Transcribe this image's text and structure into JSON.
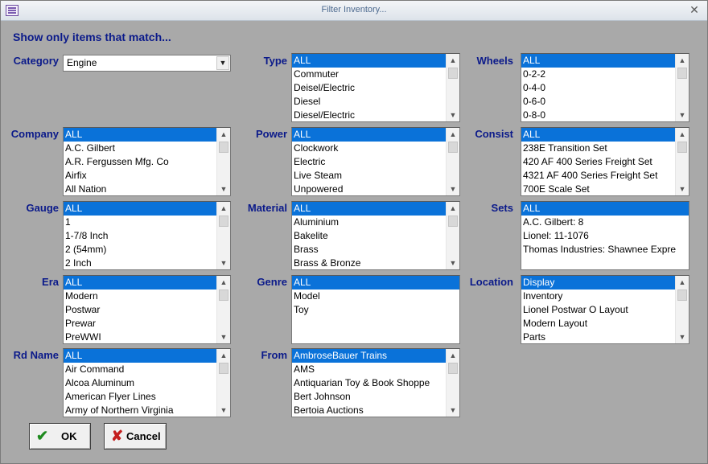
{
  "window": {
    "title": "Filter Inventory..."
  },
  "heading": "Show only items that match...",
  "category": {
    "label": "Category",
    "value": "Engine"
  },
  "lists": {
    "type": {
      "label": "Type",
      "items": [
        "ALL",
        "Commuter",
        "Deisel/Electric",
        "Diesel",
        "Diesel/Electric"
      ]
    },
    "wheels": {
      "label": "Wheels",
      "items": [
        "ALL",
        "0-2-2",
        "0-4-0",
        "0-6-0",
        "0-8-0"
      ]
    },
    "company": {
      "label": "Company",
      "items": [
        "ALL",
        "A.C. Gilbert",
        "A.R. Fergussen Mfg. Co",
        "Airfix",
        "All Nation"
      ]
    },
    "power": {
      "label": "Power",
      "items": [
        "ALL",
        "Clockwork",
        "Electric",
        "Live Steam",
        "Unpowered"
      ]
    },
    "consist": {
      "label": "Consist",
      "items": [
        "ALL",
        "238E Transition Set",
        "420 AF 400 Series Freight Set",
        "4321 AF 400 Series Freight Set",
        "700E Scale Set"
      ]
    },
    "gauge": {
      "label": "Gauge",
      "items": [
        "ALL",
        "1",
        "1-7/8 Inch",
        "2 (54mm)",
        "2 Inch"
      ]
    },
    "material": {
      "label": "Material",
      "items": [
        "ALL",
        "Aluminium",
        "Bakelite",
        "Brass",
        "Brass & Bronze"
      ]
    },
    "sets": {
      "label": "Sets",
      "items": [
        "ALL",
        "A.C. Gilbert: 8",
        "Lionel: 11-1076",
        "Thomas Industries: Shawnee Expre"
      ]
    },
    "era": {
      "label": "Era",
      "items": [
        "ALL",
        "Modern",
        "Postwar",
        "Prewar",
        "PreWWI"
      ]
    },
    "genre": {
      "label": "Genre",
      "items": [
        "ALL",
        "Model",
        "Toy"
      ]
    },
    "location": {
      "label": "Location",
      "items": [
        "Display",
        "Inventory",
        "Lionel Postwar O Layout",
        "Modern Layout",
        "Parts"
      ]
    },
    "rdname": {
      "label": "Rd Name",
      "items": [
        "ALL",
        "Air Command",
        "Alcoa Aluminum",
        "American Flyer Lines",
        "Army of Northern Virginia"
      ]
    },
    "from": {
      "label": "From",
      "items": [
        "AmbroseBauer Trains",
        "AMS",
        "Antiquarian Toy & Book Shoppe",
        "Bert Johnson",
        "Bertoia Auctions"
      ]
    }
  },
  "buttons": {
    "ok": "OK",
    "cancel": "Cancel"
  },
  "colors": {
    "background": "#a9a9a9",
    "label": "#0b1a8a",
    "selection": "#0a72d9"
  }
}
